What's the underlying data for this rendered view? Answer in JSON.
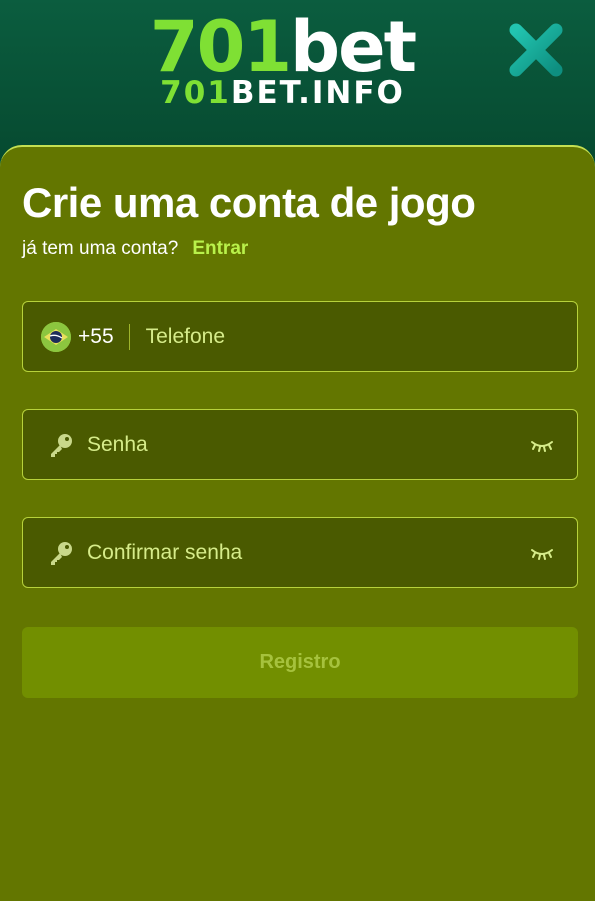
{
  "header": {
    "logo_number": "701",
    "logo_word": "bet",
    "logo_sub_number": "701",
    "logo_sub_word": "BET.INFO",
    "close_icon": "close-icon"
  },
  "form": {
    "title": "Crie uma conta de jogo",
    "subtitle": "já tem uma conta?",
    "login_link": "Entrar",
    "phone": {
      "flag_icon": "brazil-flag-icon",
      "dial_code": "+55",
      "placeholder": "Telefone"
    },
    "password": {
      "icon": "key-icon",
      "placeholder": "Senha",
      "toggle_icon": "eye-closed-icon"
    },
    "confirm_password": {
      "icon": "key-icon",
      "placeholder": "Confirmar senha",
      "toggle_icon": "eye-closed-icon"
    },
    "submit_label": "Registro"
  },
  "colors": {
    "header_bg": "#0b5d3f",
    "sheet_bg": "#637600",
    "accent": "#7fe034",
    "field_border": "#b7d23b",
    "link": "#b9f14a"
  }
}
